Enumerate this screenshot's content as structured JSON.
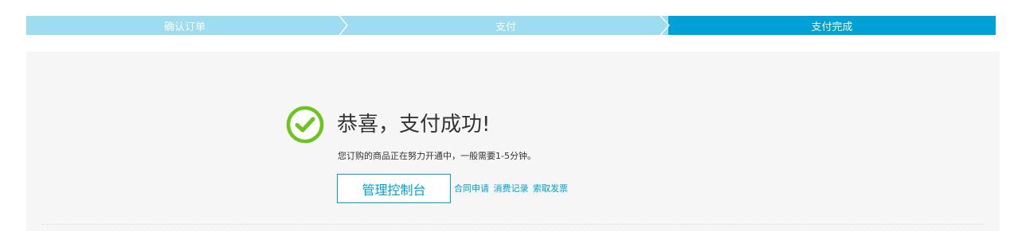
{
  "steps": [
    {
      "label": "确认订单",
      "state": "done"
    },
    {
      "label": "支付",
      "state": "done"
    },
    {
      "label": "支付完成",
      "state": "current"
    }
  ],
  "colors": {
    "step_inactive": "#9edcf2",
    "step_active": "#00a1d6",
    "accent": "#00a1d6",
    "success_green": "#6cc51f",
    "panel_bg": "#f6f6f6"
  },
  "result": {
    "icon": "check-circle-icon",
    "title": "恭喜，支付成功!",
    "message": "您订购的商品正在努力开通中，一般需要1-5分钟。",
    "primary_button": "管理控制台",
    "links": [
      "合同申请",
      "消费记录",
      "索取发票"
    ]
  }
}
